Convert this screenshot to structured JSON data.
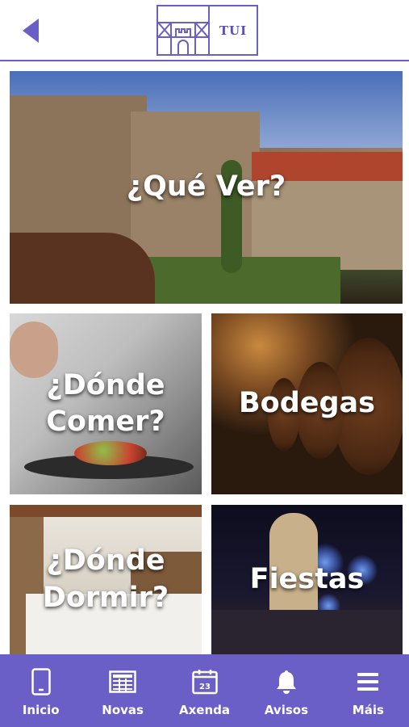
{
  "header": {
    "logo_text": "TUI"
  },
  "tiles": [
    {
      "id": "que-ver",
      "label": "¿Qué Ver?"
    },
    {
      "id": "donde-comer",
      "label": "¿Dónde\nComer?"
    },
    {
      "id": "bodegas",
      "label": "Bodegas"
    },
    {
      "id": "donde-dormir",
      "label": "¿Dónde\nDormir?"
    },
    {
      "id": "fiestas",
      "label": "Fiestas"
    }
  ],
  "tabbar": {
    "items": [
      {
        "label": "Inicio",
        "icon": "phone-icon"
      },
      {
        "label": "Novas",
        "icon": "newspaper-icon"
      },
      {
        "label": "Axenda",
        "icon": "calendar-icon",
        "calendar_day": "23"
      },
      {
        "label": "Avisos",
        "icon": "bell-icon"
      },
      {
        "label": "Máis",
        "icon": "menu-icon"
      }
    ]
  },
  "colors": {
    "brand": "#6a5fc7",
    "logo_text": "#5b50b8",
    "tab_text": "#ffffff"
  }
}
